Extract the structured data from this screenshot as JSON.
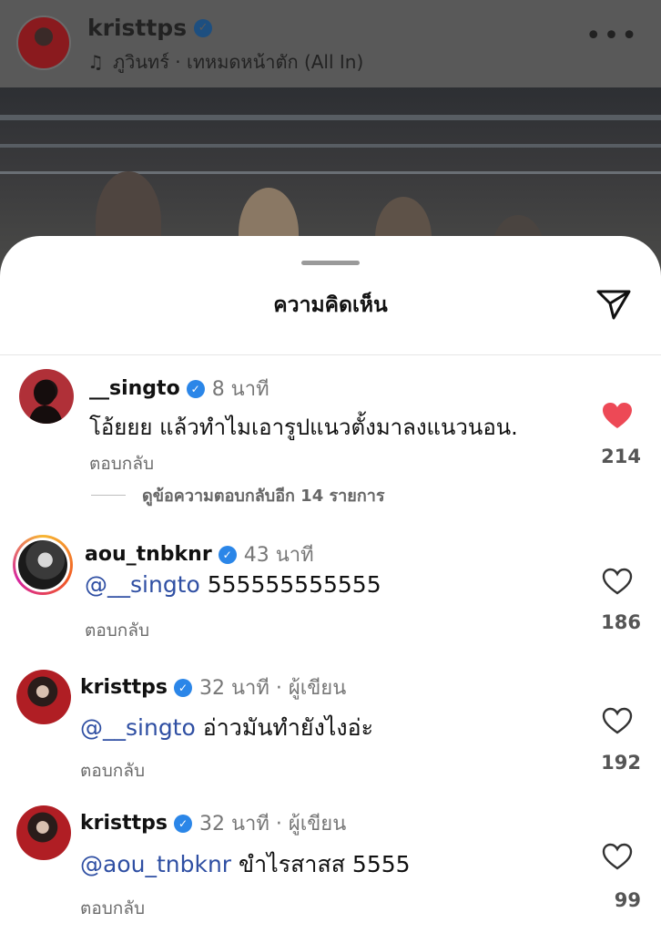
{
  "post": {
    "username": "kristtps",
    "music_note": "♫",
    "music": "ภูวินทร์ · เทหมดหน้าตัก (All In)",
    "more": "•••"
  },
  "sheet": {
    "title": "ความคิดเห็น",
    "view_replies": "ดูข้อความตอบกลับอีก 14 รายการ"
  },
  "comments": [
    {
      "username": "__singto",
      "time": "8 นาที",
      "text": "โอ้ยยย แล้วทำไมเอารูปแนวตั้งมาลงแนวนอน.",
      "reply": "ตอบกลับ",
      "likes": "214",
      "liked": true
    },
    {
      "username": "aou_tnbknr",
      "time": "43 นาที",
      "mention": "@__singto",
      "text": "555555555555",
      "reply": "ตอบกลับ",
      "likes": "186",
      "liked": false
    },
    {
      "username": "kristtps",
      "time": "32 นาที · ผู้เขียน",
      "mention": "@__singto",
      "text": "อ่าวมันทำยังไงอ่ะ",
      "reply": "ตอบกลับ",
      "likes": "192",
      "liked": false
    },
    {
      "username": "kristtps",
      "time": "32 นาที · ผู้เขียน",
      "mention": "@aou_tnbknr",
      "text": "ขำไรสาสส 5555",
      "reply": "ตอบกลับ",
      "likes": "99",
      "liked": false
    }
  ],
  "colors": {
    "verified": "#2b86e8",
    "like_active": "#ed4956",
    "mention": "#2f4fa3"
  }
}
